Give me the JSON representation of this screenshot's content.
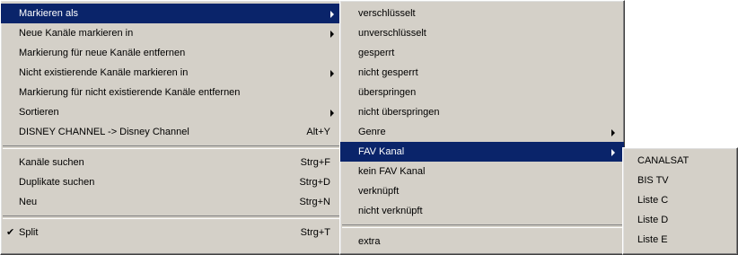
{
  "main_menu": {
    "items": [
      {
        "label": "Markieren als",
        "submenu": true,
        "highlighted": true
      },
      {
        "label": "Neue Kanäle markieren in",
        "submenu": true
      },
      {
        "label": "Markierung für neue Kanäle entfernen"
      },
      {
        "label": "Nicht existierende Kanäle markieren in",
        "submenu": true
      },
      {
        "label": "Markierung für nicht existierende Kanäle entfernen"
      },
      {
        "label": "Sortieren",
        "submenu": true
      },
      {
        "label": "DISNEY CHANNEL -> Disney Channel",
        "shortcut": "Alt+Y"
      },
      {
        "label": "Kanäle suchen",
        "shortcut": "Strg+F"
      },
      {
        "label": "Duplikate suchen",
        "shortcut": "Strg+D"
      },
      {
        "label": "Neu",
        "shortcut": "Strg+N"
      },
      {
        "label": "Split",
        "shortcut": "Strg+T",
        "checked": true,
        "check_glyph": "✔"
      }
    ]
  },
  "mark_as_submenu": {
    "items": [
      {
        "label": "verschlüsselt"
      },
      {
        "label": "unverschlüsselt"
      },
      {
        "label": "gesperrt"
      },
      {
        "label": "nicht gesperrt"
      },
      {
        "label": "überspringen"
      },
      {
        "label": "nicht überspringen"
      },
      {
        "label": "Genre",
        "submenu": true
      },
      {
        "label": "FAV Kanal",
        "submenu": true,
        "highlighted": true
      },
      {
        "label": "kein FAV Kanal"
      },
      {
        "label": "verknüpft"
      },
      {
        "label": "nicht verknüpft"
      },
      {
        "label": "extra"
      }
    ]
  },
  "fav_submenu": {
    "items": [
      {
        "label": "CANALSAT"
      },
      {
        "label": "BIS TV"
      },
      {
        "label": "Liste  C"
      },
      {
        "label": "Liste  D"
      },
      {
        "label": "Liste  E"
      }
    ]
  },
  "colors": {
    "menu_bg": "#d4d0c8",
    "highlight_bg": "#0a246a",
    "highlight_text": "#ffffff"
  }
}
